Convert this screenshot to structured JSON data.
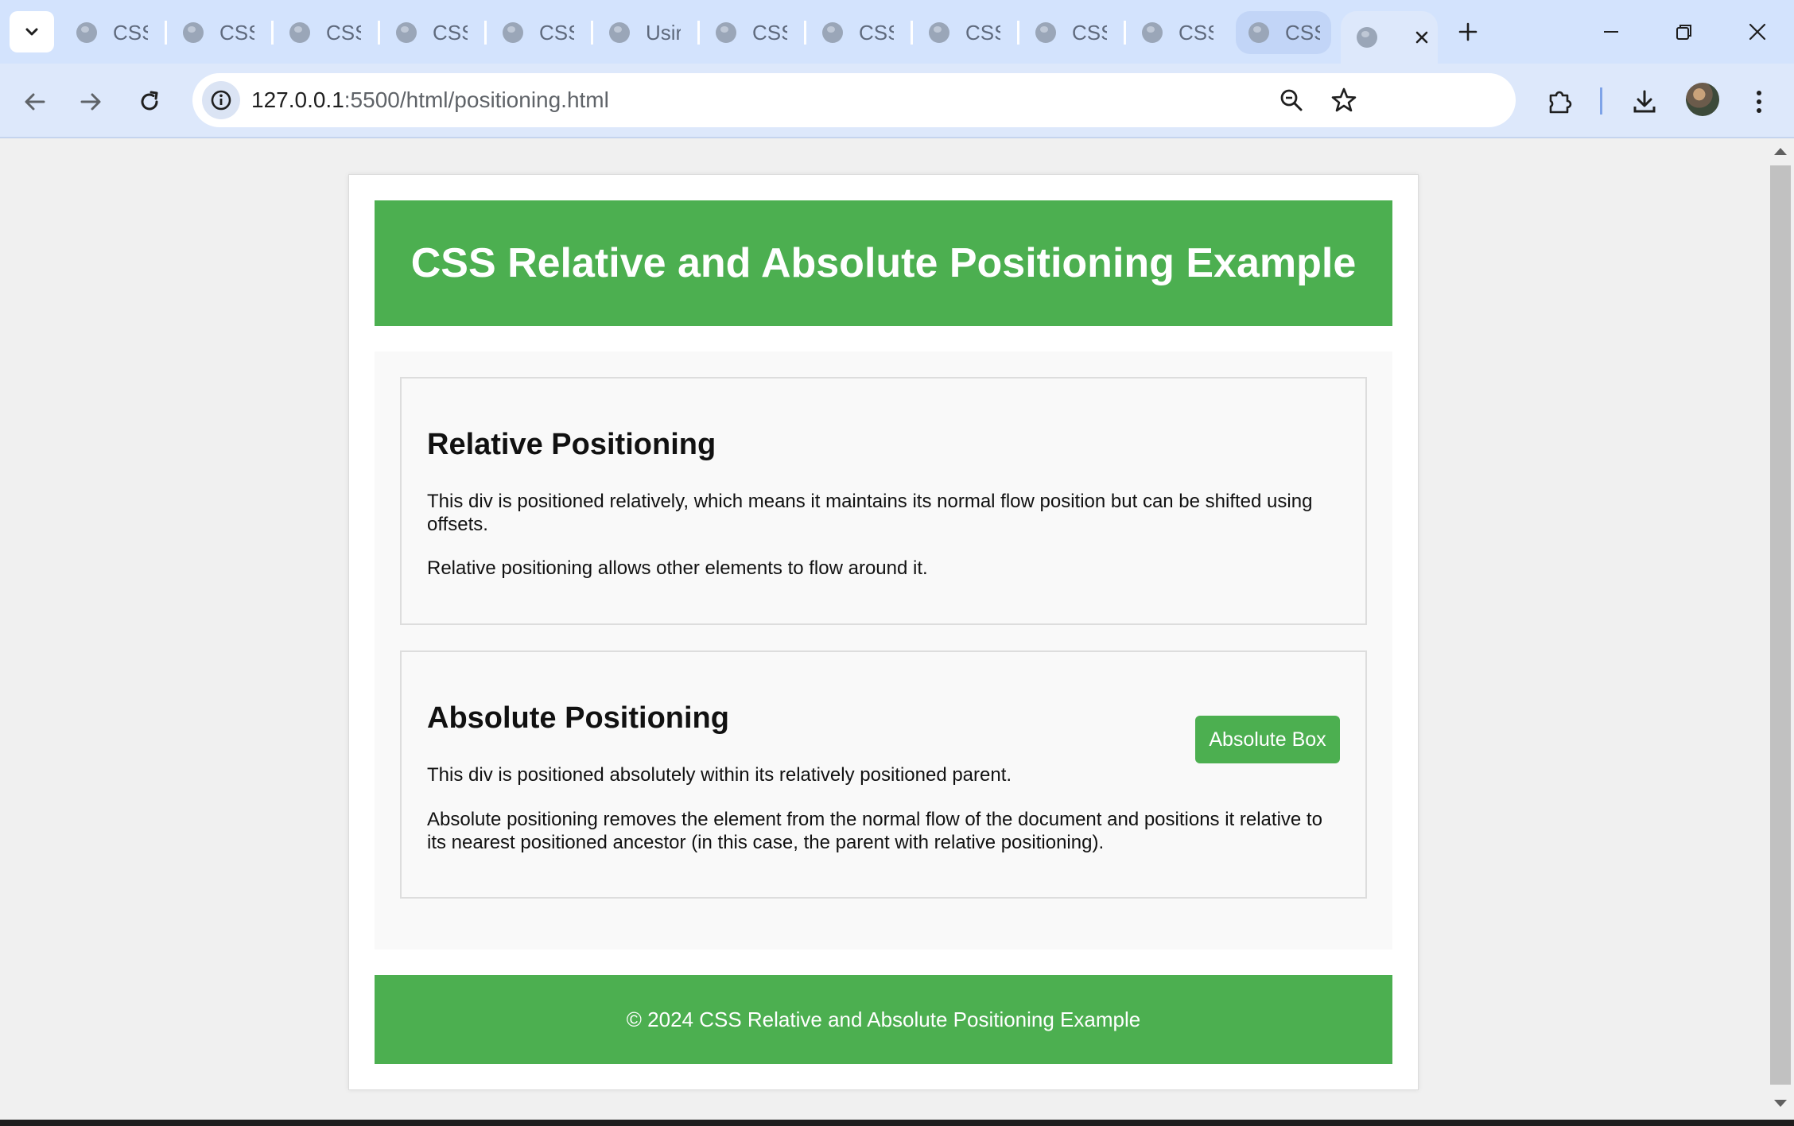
{
  "browser": {
    "tabs": [
      {
        "label": "CSS"
      },
      {
        "label": "CSS"
      },
      {
        "label": "CSS"
      },
      {
        "label": "CSS"
      },
      {
        "label": "CSS"
      },
      {
        "label": "Usir"
      },
      {
        "label": "CSS"
      },
      {
        "label": "CSS"
      },
      {
        "label": "CSS"
      },
      {
        "label": "CSS"
      },
      {
        "label": "CSS"
      },
      {
        "label": "CSS"
      }
    ],
    "address_host": "127.0.0.1",
    "address_rest": ":5500/html/positioning.html"
  },
  "page": {
    "header_title": "CSS Relative and Absolute Positioning Example",
    "relative": {
      "heading": "Relative Positioning",
      "p1": "This div is positioned relatively, which means it maintains its normal flow position but can be shifted using offsets.",
      "p2": "Relative positioning allows other elements to flow around it."
    },
    "absolute": {
      "heading": "Absolute Positioning",
      "box_label": "Absolute Box",
      "p1": "This div is positioned absolutely within its relatively positioned parent.",
      "p2": "Absolute positioning removes the element from the normal flow of the document and positions it relative to its nearest positioned ancestor (in this case, the parent with relative positioning)."
    },
    "footer_text": "© 2024 CSS Relative and Absolute Positioning Example"
  },
  "colors": {
    "accent_green": "#4caf50",
    "tab_strip": "#d3e3fd",
    "toolbar": "#dde8fb"
  }
}
